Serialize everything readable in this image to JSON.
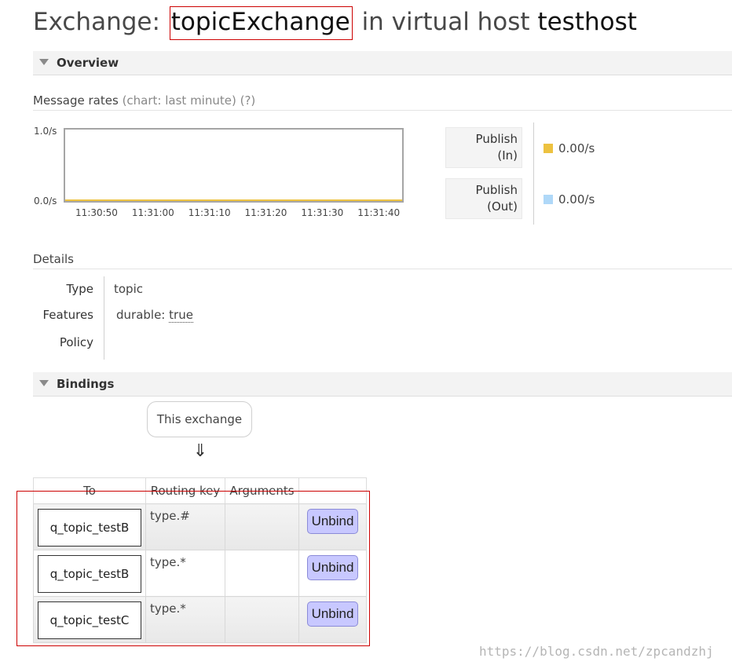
{
  "title": {
    "prefix": "Exchange: ",
    "exchange_name": "topicExchange",
    "middle": " in virtual host ",
    "vhost": "testhost"
  },
  "overview": {
    "heading": "Overview",
    "message_rates_label": "Message rates",
    "message_rates_chart_note": "(chart: last minute)",
    "help_link": "(?)"
  },
  "chart_data": {
    "type": "line",
    "x": [
      "11:30:50",
      "11:31:00",
      "11:31:10",
      "11:31:20",
      "11:31:30",
      "11:31:40"
    ],
    "series": [
      {
        "name": "Publish (In)",
        "values": [
          0,
          0,
          0,
          0,
          0,
          0
        ],
        "color": "#edc240"
      },
      {
        "name": "Publish (Out)",
        "values": [
          0,
          0,
          0,
          0,
          0,
          0
        ],
        "color": "#afd8f8"
      }
    ],
    "y_tick_labels": [
      "1.0/s",
      "0.0/s"
    ],
    "ylim": [
      0,
      1
    ],
    "grid": false
  },
  "rates": [
    {
      "label_line1": "Publish",
      "label_line2": "(In)",
      "value": "0.00/s",
      "color": "#edc240"
    },
    {
      "label_line1": "Publish",
      "label_line2": "(Out)",
      "value": "0.00/s",
      "color": "#afd8f8"
    }
  ],
  "details": {
    "heading": "Details",
    "type_label": "Type",
    "type_value": "topic",
    "features_label": "Features",
    "durable_key": "durable:",
    "durable_value": "true",
    "policy_label": "Policy"
  },
  "bindings": {
    "heading": "Bindings",
    "this_exchange": "This exchange",
    "arrow": "⇓",
    "columns": [
      "To",
      "Routing key",
      "Arguments",
      ""
    ],
    "rows": [
      {
        "to": "q_topic_testB",
        "routing_key": "type.#",
        "arguments": "",
        "action": "Unbind"
      },
      {
        "to": "q_topic_testB",
        "routing_key": "type.*",
        "arguments": "",
        "action": "Unbind"
      },
      {
        "to": "q_topic_testC",
        "routing_key": "type.*",
        "arguments": "",
        "action": "Unbind"
      }
    ]
  },
  "watermark": "https://blog.csdn.net/zpcandzhj"
}
